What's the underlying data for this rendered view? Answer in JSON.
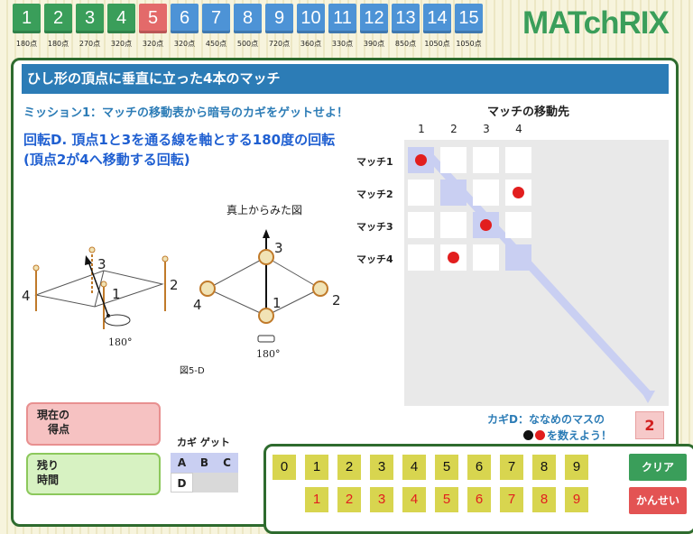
{
  "levels": [
    {
      "num": "1",
      "pts": "180点",
      "color": "green"
    },
    {
      "num": "2",
      "pts": "180点",
      "color": "green"
    },
    {
      "num": "3",
      "pts": "270点",
      "color": "green"
    },
    {
      "num": "4",
      "pts": "320点",
      "color": "green"
    },
    {
      "num": "5",
      "pts": "320点",
      "color": "red"
    },
    {
      "num": "6",
      "pts": "320点",
      "color": "blue"
    },
    {
      "num": "7",
      "pts": "450点",
      "color": "blue"
    },
    {
      "num": "8",
      "pts": "500点",
      "color": "blue"
    },
    {
      "num": "9",
      "pts": "720点",
      "color": "blue"
    },
    {
      "num": "10",
      "pts": "360点",
      "color": "blue"
    },
    {
      "num": "11",
      "pts": "330点",
      "color": "blue"
    },
    {
      "num": "12",
      "pts": "390点",
      "color": "blue"
    },
    {
      "num": "13",
      "pts": "850点",
      "color": "blue"
    },
    {
      "num": "14",
      "pts": "1050点",
      "color": "blue"
    },
    {
      "num": "15",
      "pts": "1050点",
      "color": "blue"
    }
  ],
  "logo": "MATchRIX",
  "title": "ひし形の頂点に垂直に立った4本のマッチ",
  "mission": "ミッション1：マッチの移動表から暗号のカギをゲットせよ！",
  "rotation": "回転D. 頂点1と3を通る線を軸とする180度の回転 (頂点2が4へ移動する回転)",
  "figure": {
    "top_view_label": "真上からみた図",
    "figure_number": "図5-D",
    "angle_left": "180°",
    "angle_right": "180°",
    "vertex_labels": [
      "1",
      "2",
      "3",
      "4"
    ]
  },
  "matrix": {
    "title": "マッチの移動先",
    "columns": [
      "1",
      "2",
      "3",
      "4"
    ],
    "rows": [
      "マッチ1",
      "マッチ2",
      "マッチ3",
      "マッチ4"
    ],
    "destinations": [
      1,
      4,
      3,
      2
    ]
  },
  "hint": {
    "line1": "カギD：ななめのマスの",
    "line2": "を数えよう！",
    "answer": "2"
  },
  "score": {
    "current_label_1": "現在の",
    "current_label_2": "得点",
    "remaining_label_1": "残り",
    "remaining_label_2": "時間"
  },
  "key_get": {
    "title": "カギ ゲット",
    "top": [
      "A",
      "B",
      "C"
    ],
    "bottom": [
      "D",
      "",
      ""
    ]
  },
  "pad": {
    "row1": [
      "0",
      "1",
      "2",
      "3",
      "4",
      "5",
      "6",
      "7",
      "8",
      "9"
    ],
    "row2": [
      "1",
      "2",
      "3",
      "4",
      "5",
      "6",
      "7",
      "8",
      "9"
    ],
    "clear": "クリア",
    "submit": "かんせい"
  },
  "colors": {
    "accent_green": "#3a9e5a",
    "accent_blue": "#2c7cb6",
    "dot_red": "#e21e1e",
    "diag_cell": "#c9cff2"
  }
}
